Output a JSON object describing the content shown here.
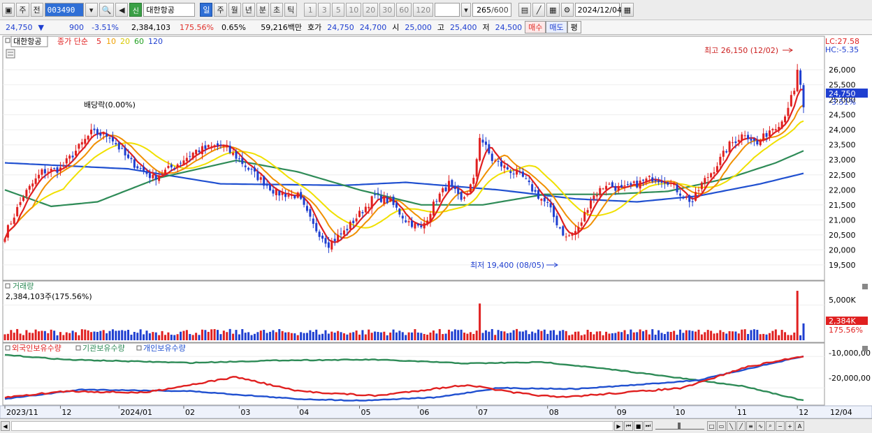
{
  "toolbar": {
    "period_tab1": "주",
    "period_tab2": "전",
    "code": "003490",
    "badge": "신",
    "stock_name": "대한항공",
    "periods": [
      "일",
      "주",
      "월",
      "년",
      "분",
      "초",
      "틱"
    ],
    "active_period": "일",
    "intervals": [
      "1",
      "3",
      "5",
      "10",
      "20",
      "30",
      "60",
      "120"
    ],
    "count": "265",
    "count_max": "/600",
    "date": "2024/12/04"
  },
  "quote": {
    "price": "24,750",
    "arrow": "▼",
    "change": "900",
    "change_pct": "-3.51%",
    "volume": "2,384,103",
    "volume_ratio": "175.56%",
    "turnover_pct": "0.65%",
    "amount": "59,216백만",
    "hoga_label": "호가",
    "ask": "24,750",
    "bid": "24,700",
    "open_label": "시",
    "open": "25,000",
    "high_label": "고",
    "high": "25,400",
    "low_label": "저",
    "low": "24,500",
    "buy_label": "매수",
    "sell_label": "매도",
    "eval_label": "평"
  },
  "legend": {
    "name": "대한항공",
    "main_label": "종가 단순",
    "ma": [
      {
        "period": "5",
        "color": "#e02020"
      },
      {
        "period": "10",
        "color": "#f0a000"
      },
      {
        "period": "20",
        "color": "#e8e000"
      },
      {
        "period": "60",
        "color": "#20a020"
      },
      {
        "period": "120",
        "color": "#2040d0"
      }
    ]
  },
  "annotations": {
    "high": "최고 26,150 (12/02)",
    "low": "최저 19,400 (08/05)",
    "dividend": "배당락(0.00%)",
    "lc": "LC:27.58",
    "hc": "HC:-5.35",
    "current_price_label": "24,750",
    "current_change_label": "-3.51%"
  },
  "volume_panel": {
    "title": "거래량",
    "value_text": "2,384,103주(175.56%)",
    "axis_label": "5,000K",
    "current_label": "2,384K",
    "current_pct": "175.56%"
  },
  "holding_panel": {
    "legend": [
      {
        "label": "외국인보유수량",
        "color": "#e02020"
      },
      {
        "label": "기관보유수량",
        "color": "#2e8b57"
      },
      {
        "label": "개인보유수량",
        "color": "#2050d0"
      }
    ],
    "axis_labels": [
      "-10,000,00",
      "-20,000,00"
    ]
  },
  "chart_data": {
    "type": "candlestick",
    "price_axis": [
      26000,
      25500,
      25000,
      24500,
      24000,
      23500,
      23000,
      22500,
      22000,
      21500,
      21000,
      20500,
      20000,
      19500
    ],
    "price_axis_labels": [
      "26,000",
      "25,500",
      "25,000",
      "24,500",
      "24,000",
      "23,500",
      "23,000",
      "22,500",
      "22,000",
      "21,500",
      "21,000",
      "20,500",
      "20,000",
      "19,500"
    ],
    "ylim": [
      19150,
      27000
    ],
    "x_ticks": [
      {
        "label": "2023/11",
        "index": 0
      },
      {
        "label": "12",
        "index": 18
      },
      {
        "label": "2024/01",
        "index": 37
      },
      {
        "label": "02",
        "index": 58
      },
      {
        "label": "03",
        "index": 76
      },
      {
        "label": "04",
        "index": 95
      },
      {
        "label": "05",
        "index": 115
      },
      {
        "label": "06",
        "index": 134
      },
      {
        "label": "07",
        "index": 153
      },
      {
        "label": "08",
        "index": 176
      },
      {
        "label": "09",
        "index": 198
      },
      {
        "label": "10",
        "index": 217
      },
      {
        "label": "11",
        "index": 237
      },
      {
        "label": "12",
        "index": 257
      }
    ],
    "last_x_label": "12/04",
    "n_bars": 260,
    "close_anchors": [
      [
        0,
        20500
      ],
      [
        6,
        21800
      ],
      [
        12,
        22600
      ],
      [
        18,
        22700
      ],
      [
        28,
        23900
      ],
      [
        34,
        23800
      ],
      [
        40,
        23000
      ],
      [
        48,
        22400
      ],
      [
        55,
        22800
      ],
      [
        62,
        23300
      ],
      [
        70,
        23500
      ],
      [
        75,
        23100
      ],
      [
        80,
        22600
      ],
      [
        88,
        21900
      ],
      [
        95,
        21800
      ],
      [
        100,
        20800
      ],
      [
        105,
        20200
      ],
      [
        110,
        20600
      ],
      [
        115,
        21200
      ],
      [
        120,
        21800
      ],
      [
        125,
        21600
      ],
      [
        130,
        21000
      ],
      [
        135,
        20700
      ],
      [
        140,
        21700
      ],
      [
        144,
        22200
      ],
      [
        148,
        21600
      ],
      [
        152,
        22300
      ],
      [
        154,
        23800
      ],
      [
        158,
        23000
      ],
      [
        163,
        22700
      ],
      [
        168,
        22400
      ],
      [
        172,
        21900
      ],
      [
        176,
        21500
      ],
      [
        179,
        20900
      ],
      [
        182,
        20400
      ],
      [
        186,
        20700
      ],
      [
        190,
        21700
      ],
      [
        195,
        22200
      ],
      [
        200,
        22000
      ],
      [
        205,
        22200
      ],
      [
        210,
        22400
      ],
      [
        215,
        22300
      ],
      [
        220,
        21800
      ],
      [
        223,
        21600
      ],
      [
        226,
        22200
      ],
      [
        230,
        22700
      ],
      [
        235,
        23500
      ],
      [
        240,
        23900
      ],
      [
        244,
        23500
      ],
      [
        248,
        24000
      ],
      [
        252,
        24300
      ],
      [
        256,
        25300
      ],
      [
        257,
        26000
      ],
      [
        258,
        25500
      ],
      [
        259,
        24750
      ]
    ],
    "ma60_anchors": [
      [
        0,
        22000
      ],
      [
        15,
        21450
      ],
      [
        30,
        21600
      ],
      [
        50,
        22400
      ],
      [
        75,
        22980
      ],
      [
        95,
        22600
      ],
      [
        115,
        22000
      ],
      [
        135,
        21500
      ],
      [
        155,
        21500
      ],
      [
        175,
        21850
      ],
      [
        195,
        21850
      ],
      [
        215,
        21950
      ],
      [
        235,
        22400
      ],
      [
        250,
        22900
      ],
      [
        259,
        23300
      ]
    ],
    "ma120_anchors": [
      [
        0,
        22900
      ],
      [
        40,
        22700
      ],
      [
        70,
        22200
      ],
      [
        110,
        22150
      ],
      [
        130,
        22250
      ],
      [
        160,
        22000
      ],
      [
        185,
        21700
      ],
      [
        205,
        21600
      ],
      [
        225,
        21800
      ],
      [
        245,
        22200
      ],
      [
        259,
        22550
      ]
    ],
    "volume": {
      "current": 2384103,
      "max_marker": 5000000,
      "spikes": [
        {
          "index": 154,
          "value": 5200000
        },
        {
          "index": 257,
          "value": 7000000
        }
      ]
    },
    "holding": {
      "foreign": [
        [
          0,
          -23000000
        ],
        [
          20,
          -21000000
        ],
        [
          45,
          -21500000
        ],
        [
          75,
          -16500000
        ],
        [
          95,
          -21000000
        ],
        [
          120,
          -22500000
        ],
        [
          150,
          -19000000
        ],
        [
          165,
          -21500000
        ],
        [
          180,
          -23000000
        ],
        [
          200,
          -21500000
        ],
        [
          220,
          -20000000
        ],
        [
          240,
          -13500000
        ],
        [
          259,
          -9800000
        ]
      ],
      "institution": [
        [
          0,
          -9500000
        ],
        [
          20,
          -11000000
        ],
        [
          60,
          -12000000
        ],
        [
          90,
          -11200000
        ],
        [
          120,
          -11000000
        ],
        [
          150,
          -12200000
        ],
        [
          175,
          -11800000
        ],
        [
          200,
          -14500000
        ],
        [
          220,
          -17000000
        ],
        [
          240,
          -19500000
        ],
        [
          259,
          -24000000
        ]
      ],
      "individual": [
        [
          0,
          -23500000
        ],
        [
          25,
          -20500000
        ],
        [
          60,
          -21000000
        ],
        [
          95,
          -23500000
        ],
        [
          115,
          -24000000
        ],
        [
          140,
          -23000000
        ],
        [
          160,
          -20000000
        ],
        [
          185,
          -20300000
        ],
        [
          205,
          -19000000
        ],
        [
          225,
          -17500000
        ],
        [
          245,
          -13000000
        ],
        [
          259,
          -10000000
        ]
      ],
      "ylim": [
        -25000000,
        -7500000
      ]
    }
  }
}
